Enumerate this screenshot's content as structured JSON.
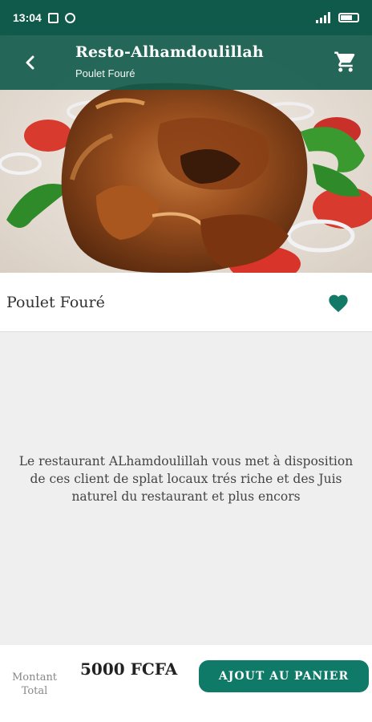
{
  "status_bar": {
    "time": "13:04"
  },
  "header": {
    "title": "Resto-Alhamdoulillah",
    "subtitle": "Poulet Fouré",
    "back_icon": "chevron-left-icon",
    "cart_icon": "shopping-cart-icon"
  },
  "product": {
    "name": "Poulet Fouré",
    "favorite_icon": "heart-icon",
    "description": "Le restaurant ALhamdoulillah vous met à disposition de ces client de splat locaux trés riche et des Juis naturel du restaurant et plus encors"
  },
  "footer": {
    "total_label": "Montant Total",
    "price": "5000 FCFA",
    "add_to_cart_label": "AJOUT AU PANIER"
  },
  "colors": {
    "primary": "#0f5a4a",
    "button": "#0f7a68"
  }
}
